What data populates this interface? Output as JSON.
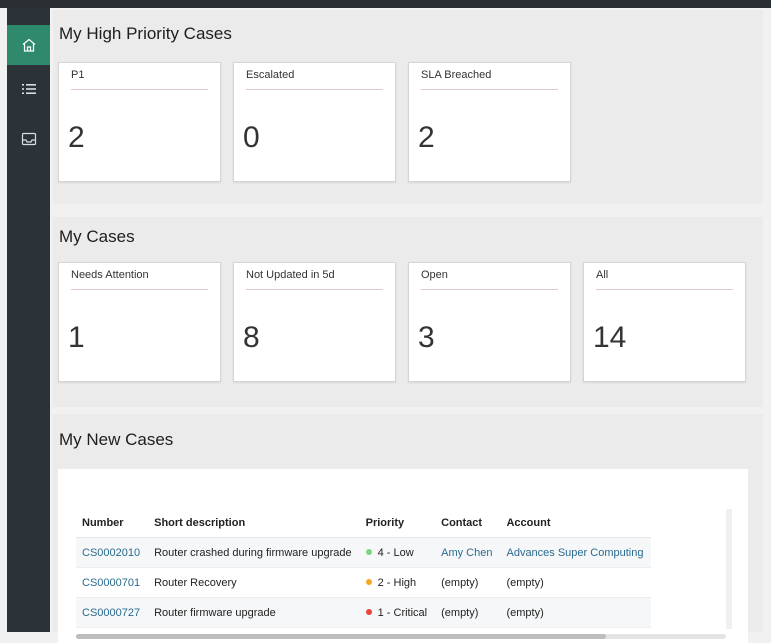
{
  "sidebar": {
    "items": [
      {
        "icon": "home-icon",
        "active": true
      },
      {
        "icon": "list-icon",
        "active": false
      },
      {
        "icon": "inbox-icon",
        "active": false
      }
    ]
  },
  "high_priority": {
    "title": "My High Priority Cases",
    "tiles": [
      {
        "label": "P1",
        "value": "2"
      },
      {
        "label": "Escalated",
        "value": "0"
      },
      {
        "label": "SLA Breached",
        "value": "2"
      }
    ]
  },
  "my_cases": {
    "title": "My Cases",
    "tiles": [
      {
        "label": "Needs Attention",
        "value": "1"
      },
      {
        "label": "Not Updated in 5d",
        "value": "8"
      },
      {
        "label": "Open",
        "value": "3"
      },
      {
        "label": "All",
        "value": "14"
      }
    ]
  },
  "new_cases": {
    "title": "My New Cases",
    "columns": [
      "Number",
      "Short description",
      "Priority",
      "Contact",
      "Account"
    ],
    "rows": [
      {
        "number": "CS0002010",
        "description": "Router crashed during firmware upgrade",
        "priority": "4 - Low",
        "priority_color": "#7ed37e",
        "contact": "Amy Chen",
        "account": "Advances Super Computing"
      },
      {
        "number": "CS0000701",
        "description": "Router Recovery",
        "priority": "2 - High",
        "priority_color": "#f5a623",
        "contact": "(empty)",
        "account": "(empty)"
      },
      {
        "number": "CS0000727",
        "description": "Router firmware upgrade",
        "priority": "1 - Critical",
        "priority_color": "#e8453c",
        "contact": "(empty)",
        "account": "(empty)"
      }
    ]
  },
  "colors": {
    "accent": "#2f8a6d",
    "sidebar": "#2c3338",
    "link": "#2a6b8f"
  }
}
